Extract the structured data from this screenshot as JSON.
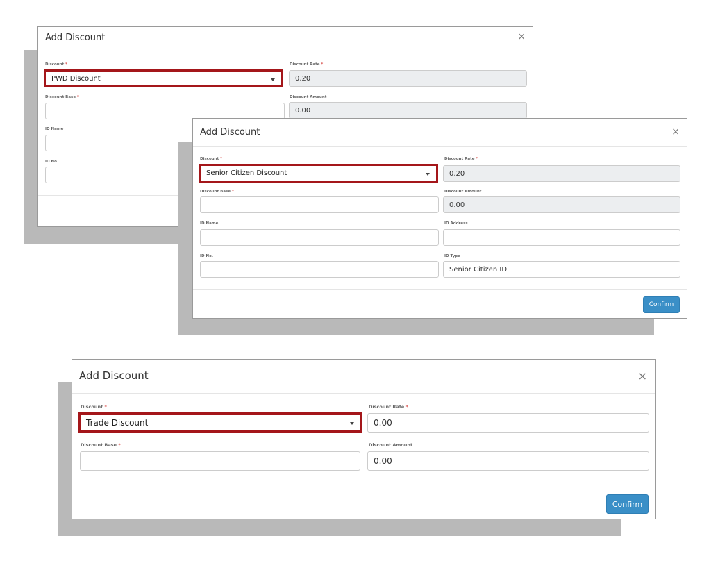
{
  "dialog_1": {
    "title": "Add Discount",
    "close": "×",
    "discount_label": "Discount",
    "discount_value": "PWD Discount",
    "discount_rate_label": "Discount Rate",
    "discount_rate_value": "0.20",
    "discount_base_label": "Discount Base",
    "discount_base_value": "",
    "discount_amount_label": "Discount Amount",
    "discount_amount_value": "0.00",
    "id_name_label": "ID Name",
    "id_no_label": "ID No."
  },
  "dialog_2": {
    "title": "Add Discount",
    "close": "×",
    "discount_label": "Discount",
    "discount_value": "Senior Citizen Discount",
    "discount_rate_label": "Discount Rate",
    "discount_rate_value": "0.20",
    "discount_base_label": "Discount Base",
    "discount_base_value": "",
    "discount_amount_label": "Discount Amount",
    "discount_amount_value": "0.00",
    "id_name_label": "ID Name",
    "id_name_value": "",
    "id_address_label": "ID Address",
    "id_address_value": "",
    "id_no_label": "ID No.",
    "id_no_value": "",
    "id_type_label": "ID Type",
    "id_type_value": "Senior Citizen ID",
    "confirm_label": "Confirm"
  },
  "dialog_3": {
    "title": "Add Discount",
    "close": "×",
    "discount_label": "Discount",
    "discount_value": "Trade Discount",
    "discount_rate_label": "Discount Rate",
    "discount_rate_value": "0.00",
    "discount_base_label": "Discount Base",
    "discount_base_value": "",
    "discount_amount_label": "Discount Amount",
    "discount_amount_value": "0.00",
    "confirm_label": "Confirm"
  },
  "required_marker": "*",
  "colors": {
    "highlight_border": "#a4161a",
    "primary_button": "#3a8fc7",
    "required": "#d9534f",
    "readonly_field": "#eceef0"
  }
}
